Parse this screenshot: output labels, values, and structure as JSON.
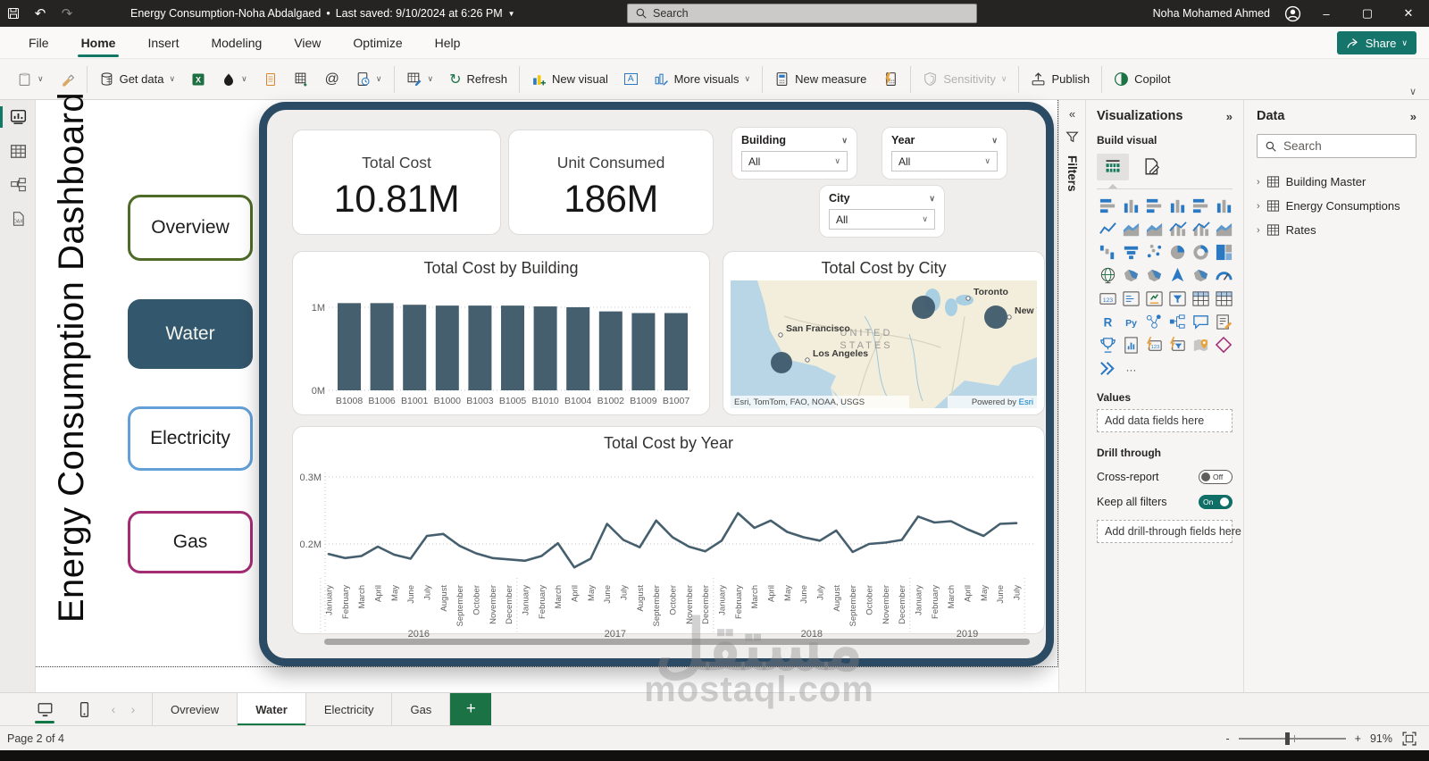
{
  "colors": {
    "accent_teal": "#117865",
    "tab_green": "#117845",
    "plus_green": "#1b7245",
    "frame_navy": "#2b4a63",
    "series": "#465f6e",
    "bubble": "#3e5a6c",
    "nav_overview_border": "#4e6b28",
    "nav_water_fill": "#33576c",
    "nav_electricity_border": "#64a0d8",
    "nav_gas_border": "#a32c74",
    "map_ocean": "#b8d6e6",
    "map_land": "#f2eedb"
  },
  "titlebar": {
    "title": "Energy Consumption-Noha Abdalgaed",
    "last_saved": "Last saved: 9/10/2024 at 6:26 PM",
    "search_placeholder": "Search",
    "user": "Noha Mohamed Ahmed",
    "minimize": "–",
    "maximize": "▢",
    "close": "✕"
  },
  "menu": {
    "items": [
      "File",
      "Home",
      "Insert",
      "Modeling",
      "View",
      "Optimize",
      "Help"
    ],
    "active": "Home",
    "share_label": "Share"
  },
  "ribbon": {
    "get_data": "Get data",
    "refresh": "Refresh",
    "new_visual": "New visual",
    "more_visuals": "More visuals",
    "new_measure": "New measure",
    "sensitivity": "Sensitivity",
    "publish": "Publish",
    "copilot": "Copilot"
  },
  "canvas": {
    "vertical_title": "Energy Consumption Dashboard",
    "nav_buttons": [
      {
        "label": "Overview",
        "style": "outline",
        "color": "#4e6b28"
      },
      {
        "label": "Water",
        "style": "fill",
        "color": "#33576c"
      },
      {
        "label": "Electricity",
        "style": "outline",
        "color": "#64a0d8"
      },
      {
        "label": "Gas",
        "style": "outline",
        "color": "#a32c74"
      }
    ],
    "kpi_cards": [
      {
        "title": "Total Cost",
        "value": "10.81M"
      },
      {
        "title": "Unit Consumed",
        "value": "186M"
      }
    ],
    "slicers": [
      {
        "label": "Building",
        "value": "All"
      },
      {
        "label": "Year",
        "value": "All"
      },
      {
        "label": "City",
        "value": "All"
      }
    ]
  },
  "chart_data": [
    {
      "type": "bar",
      "title": "Total Cost by Building",
      "categories": [
        "B1008",
        "B1006",
        "B1001",
        "B1000",
        "B1003",
        "B1005",
        "B1010",
        "B1004",
        "B1002",
        "B1009",
        "B1007"
      ],
      "values": [
        1.05,
        1.05,
        1.03,
        1.02,
        1.02,
        1.02,
        1.01,
        1.0,
        0.95,
        0.93,
        0.93
      ],
      "yticks": [
        {
          "label": "1M",
          "value": 1
        },
        {
          "label": "0M",
          "value": 0
        }
      ],
      "ylim": [
        0,
        1.3
      ],
      "grid": "dotted",
      "legend": "none"
    },
    {
      "type": "map",
      "title": "Total Cost by City",
      "region_label": "UNITED STATES",
      "city_labels": [
        {
          "name": "San Francisco",
          "x": 62,
          "y": 57
        },
        {
          "name": "Los Angeles",
          "x": 92,
          "y": 85
        },
        {
          "name": "Toronto",
          "x": 272,
          "y": 16
        },
        {
          "name": "New York",
          "x": 318,
          "y": 37
        }
      ],
      "bubbles": [
        {
          "label": "Los Angeles",
          "x": 57,
          "y": 92,
          "r": 12
        },
        {
          "label": "",
          "x": 216,
          "y": 30,
          "r": 13
        },
        {
          "label": "New York",
          "x": 297,
          "y": 41,
          "r": 13
        }
      ],
      "attribution": "Esri, TomTom, FAO, NOAA, USGS",
      "powered_by": "Powered by Esri"
    },
    {
      "type": "line",
      "title": "Total Cost by Year",
      "month_names": [
        "January",
        "February",
        "March",
        "April",
        "May",
        "June",
        "July",
        "August",
        "September",
        "October",
        "November",
        "December"
      ],
      "groups": [
        {
          "year": "2016",
          "count": 12
        },
        {
          "year": "2017",
          "count": 12
        },
        {
          "year": "2018",
          "count": 12
        },
        {
          "year": "2019",
          "count": 7
        }
      ],
      "values": [
        0.185,
        0.179,
        0.182,
        0.196,
        0.184,
        0.178,
        0.212,
        0.215,
        0.197,
        0.186,
        0.179,
        0.177,
        0.175,
        0.182,
        0.201,
        0.165,
        0.178,
        0.23,
        0.206,
        0.195,
        0.235,
        0.21,
        0.196,
        0.189,
        0.205,
        0.246,
        0.224,
        0.235,
        0.218,
        0.21,
        0.205,
        0.22,
        0.188,
        0.2,
        0.202,
        0.206,
        0.241,
        0.232,
        0.234,
        0.222,
        0.212,
        0.23,
        0.231
      ],
      "yticks": [
        {
          "label": "0.3M",
          "value": 0.3
        },
        {
          "label": "0.2M",
          "value": 0.2
        }
      ],
      "ylim": [
        0.15,
        0.32
      ],
      "grid": "dotted",
      "legend": "none"
    }
  ],
  "filters_panel": {
    "label": "Filters"
  },
  "visualizations": {
    "title": "Visualizations",
    "build_visual": "Build visual",
    "gallery": [
      "stacked-bar-chart",
      "stacked-column-chart",
      "clustered-bar-chart",
      "clustered-column-chart",
      "100-stacked-bar-chart",
      "100-stacked-column-chart",
      "line-chart",
      "area-chart",
      "stacked-area-chart",
      "line-and-stacked-column-chart",
      "line-and-clustered-column-chart",
      "ribbon-chart",
      "waterfall-chart",
      "funnel-chart",
      "scatter-chart",
      "pie-chart",
      "donut-chart",
      "treemap",
      "map",
      "filled-map",
      "shape-map",
      "azure-map",
      "arcgis-map",
      "gauge",
      "card",
      "multi-row-card",
      "kpi",
      "slicer",
      "table",
      "matrix",
      "r-script-visual",
      "python-visual",
      "key-influencers",
      "decomposition-tree",
      "qa-visual",
      "smart-narrative",
      "metrics",
      "paginated-report",
      "quick-create-card",
      "quick-create-slicer",
      "pinned-map",
      "shape",
      "power-automate",
      "more-options"
    ],
    "values_label": "Values",
    "values_placeholder": "Add data fields here",
    "drill_through_label": "Drill through",
    "cross_report_label": "Cross-report",
    "cross_report_state": "Off",
    "keep_all_filters_label": "Keep all filters",
    "keep_all_filters_state": "On",
    "drill_placeholder": "Add drill-through fields here"
  },
  "data_panel": {
    "title": "Data",
    "search_placeholder": "Search",
    "tables": [
      "Building Master",
      "Energy Consumptions",
      "Rates"
    ]
  },
  "pages": {
    "tabs": [
      "Ovreview",
      "Water",
      "Electricity",
      "Gas"
    ],
    "active": "Water",
    "add_label": "+"
  },
  "statusbar": {
    "page": "Page 2 of 4",
    "zoom": "91%",
    "minus": "-",
    "plus": "+"
  },
  "watermark": {
    "arabic": "مستقل",
    "latin": "mostaql.com"
  }
}
